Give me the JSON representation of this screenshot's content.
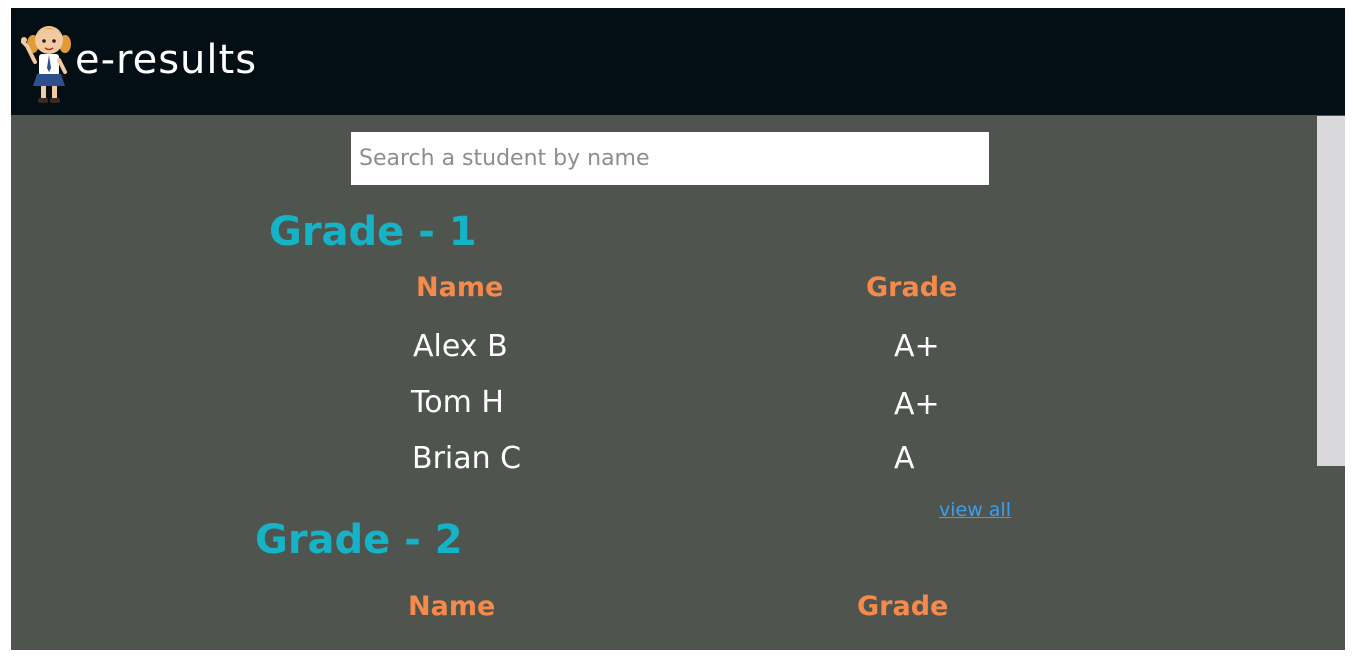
{
  "header": {
    "brand": "e-results"
  },
  "search": {
    "placeholder": "Search a student by name",
    "value": ""
  },
  "grades": [
    {
      "title": "Grade - 1",
      "columns": [
        "Name",
        "Grade"
      ],
      "rows": [
        {
          "name": "Alex B",
          "grade": "A+"
        },
        {
          "name": "Tom H",
          "grade": "A+"
        },
        {
          "name": "Brian C",
          "grade": "A"
        }
      ],
      "view_all": "view all"
    },
    {
      "title": "Grade - 2",
      "columns": [
        "Name",
        "Grade"
      ]
    }
  ],
  "colors": {
    "header_bg": "#040f15",
    "page_bg": "#50544e",
    "grade_heading": "#16b3c6",
    "column_heading": "#f58a4b",
    "link": "#3b9ff0"
  }
}
